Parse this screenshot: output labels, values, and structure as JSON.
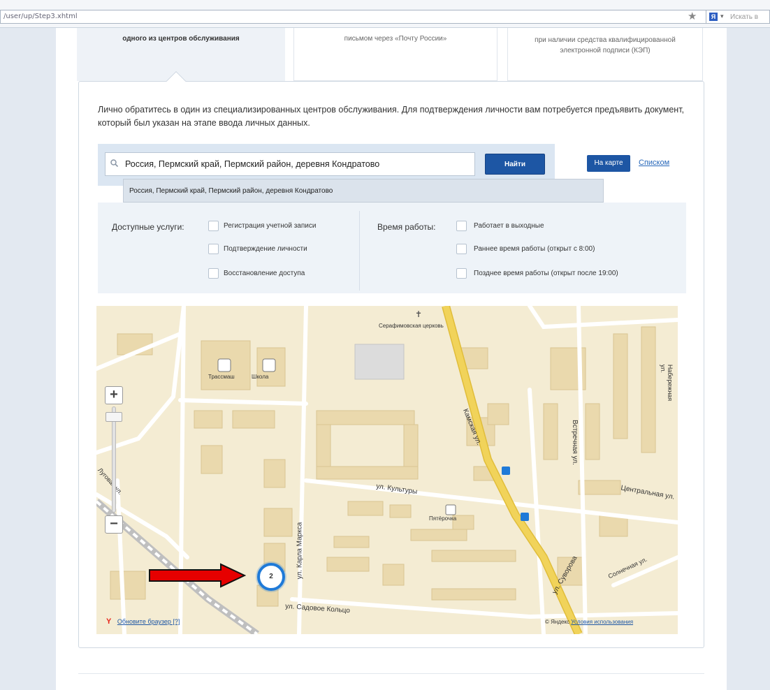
{
  "browser": {
    "url": "/user/up/Step3.xhtml",
    "search_engine_placeholder": "Искать в"
  },
  "tabs": [
    {
      "label": "одного из центров обслуживания"
    },
    {
      "label": "письмом через «Почту России»"
    },
    {
      "label": "при наличии средства квалифицированной электронной подписи (КЭП)"
    }
  ],
  "intro": "Лично обратитесь в один из специализированных центров обслуживания. Для подтверждения личности вам потребуется предъявить документ, который был указан на этапе ввода личных данных.",
  "search": {
    "value": "Россия, Пермский край, Пермский район, деревня Кондратово",
    "find_label": "Найти",
    "map_view_label": "На карте",
    "list_view_label": "Списком",
    "suggestion": "Россия, Пермский край, Пермский район, деревня Кондратово"
  },
  "filters": {
    "services_label": "Доступные услуги:",
    "services": [
      {
        "label": "Регистрация учетной записи",
        "checked": false
      },
      {
        "label": "Подтверждение личности",
        "checked": false
      },
      {
        "label": "Восстановление доступа",
        "checked": false
      }
    ],
    "hours_label": "Время работы:",
    "hours": [
      {
        "label": "Работает в выходные",
        "checked": false
      },
      {
        "label": "Раннее время работы (открыт с 8:00)",
        "checked": false
      },
      {
        "label": "Позднее время работы (открыт после 19:00)",
        "checked": false
      }
    ]
  },
  "map": {
    "streets": [
      "Камская ул.",
      "ул. Культуры",
      "ул. Садовое Кольцо",
      "ул. Карла Маркса",
      "ул. Суворова",
      "Встречная ул.",
      "Центральная ул.",
      "Набережная ул.",
      "Солнечная ул.",
      "Луговая ул."
    ],
    "pois": [
      "Серафимовская церковь",
      "Пятёрочка",
      "Трассмаш",
      "Школа"
    ],
    "cluster_count": "2",
    "update_browser": "Обновите браузер [?]",
    "copyright": "© Яндекс",
    "terms_link": "Условия использования",
    "yandex_logo": "Y"
  },
  "colors": {
    "primary": "#1d56a4",
    "cluster": "#1f7ad8",
    "arrow": "#e60000",
    "map_bg": "#f4ecd3",
    "road_main": "#f1d35a"
  }
}
